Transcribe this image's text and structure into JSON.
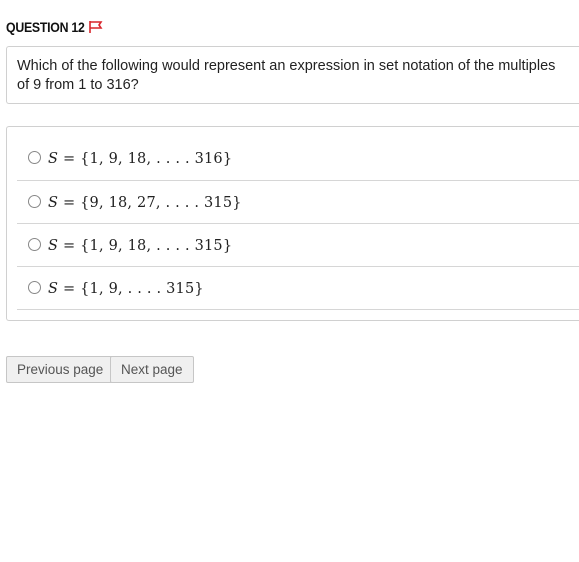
{
  "question": {
    "title": "QUESTION 12",
    "flag_icon": "flag-icon",
    "flag_color": "#d9262c",
    "prompt": "Which of the following would represent an expression in set notation of the multiples of 9 from 1 to 316?"
  },
  "options": [
    {
      "var": "S",
      "expr": " = {1, 9, 18, . . . . 316}"
    },
    {
      "var": "S",
      "expr": " = {9, 18, 27, . . . . 315}"
    },
    {
      "var": "S",
      "expr": " = {1, 9, 18, . . . . 315}"
    },
    {
      "var": "S",
      "expr": " = {1, 9, . . . . 315}"
    }
  ],
  "navigation": {
    "previous_label": "Previous page",
    "next_label": "Next page"
  }
}
